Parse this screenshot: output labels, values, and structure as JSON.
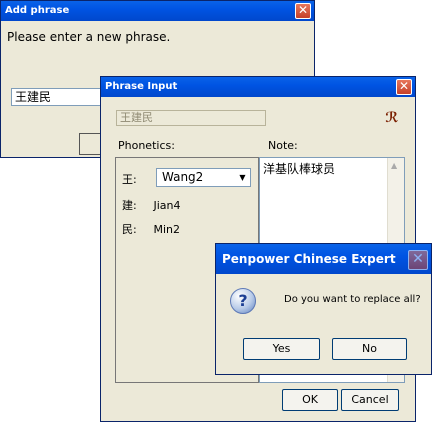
{
  "add_phrase": {
    "title": "Add phrase",
    "close_glyph": "✕",
    "prompt": "Please enter a new phrase.",
    "input_value": "王建民"
  },
  "phrase_input": {
    "title": "Phrase Input",
    "close_glyph": "✕",
    "readonly_value": "王建民",
    "tool_glyph": "ℛ",
    "phonetics_label": "Phonetics:",
    "note_label": "Note:",
    "phonetics": [
      {
        "char": "王:",
        "reading": "Wang2",
        "dropdown": true
      },
      {
        "char": "建:",
        "reading": "Jian4",
        "dropdown": false
      },
      {
        "char": "民:",
        "reading": "Min2",
        "dropdown": false
      }
    ],
    "note_text": "洋基队棒球员",
    "ok_label": "OK",
    "cancel_label": "Cancel"
  },
  "penpower": {
    "title": "Penpower Chinese Expert",
    "close_glyph": "✕",
    "icon_glyph": "?",
    "message": "Do you want to replace all?",
    "yes_label": "Yes",
    "no_label": "No"
  }
}
